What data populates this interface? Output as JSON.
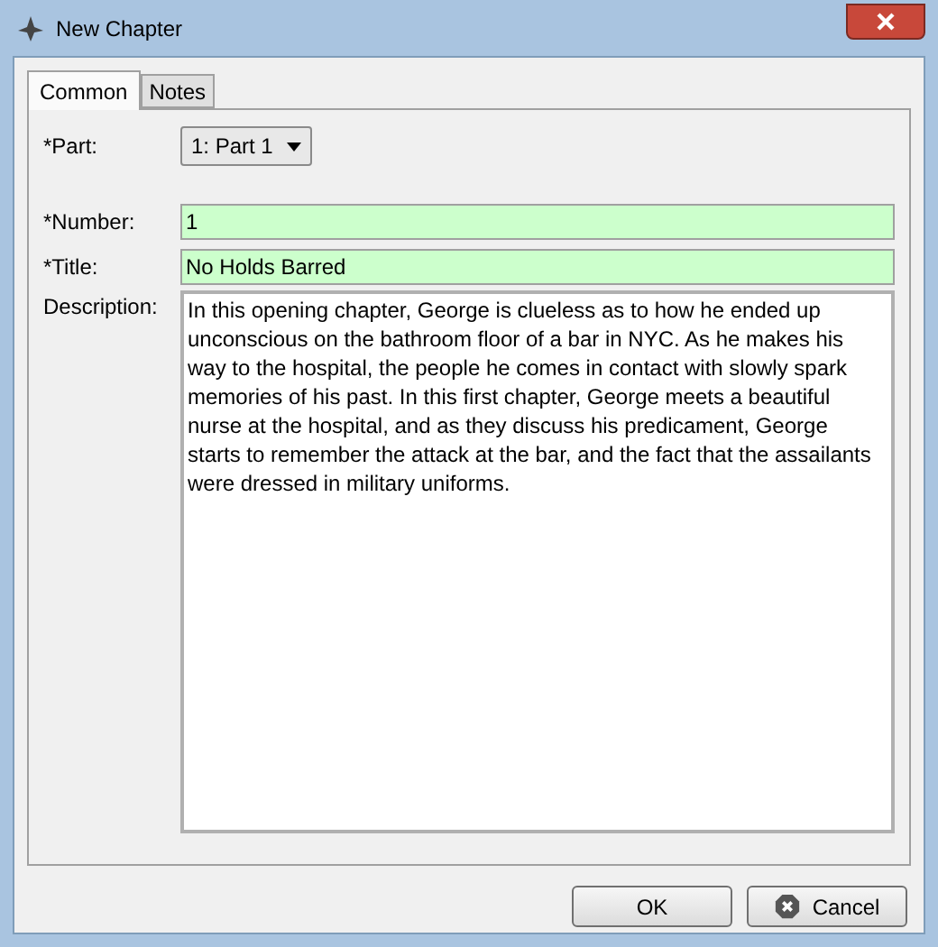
{
  "window": {
    "title": "New Chapter"
  },
  "tabs": [
    {
      "label": "Common",
      "selected": true
    },
    {
      "label": "Notes",
      "selected": false
    }
  ],
  "form": {
    "part": {
      "label": "*Part:",
      "value": "1: Part 1"
    },
    "number": {
      "label": "*Number:",
      "value": "1"
    },
    "title": {
      "label": "*Title:",
      "value": "No Holds Barred"
    },
    "description": {
      "label": "Description:",
      "value": "In this opening chapter, George is clueless as to how he ended up unconscious on the bathroom floor of a bar in NYC. As he makes his way to the hospital, the people he comes in contact with slowly spark memories of his past. In this first chapter, George meets a beautiful nurse at the hospital, and as they discuss his predicament, George starts to remember the attack at the bar, and the fact that the assailants were dressed in military uniforms."
    }
  },
  "buttons": [
    {
      "label": "OK",
      "kind": "ok"
    },
    {
      "label": "Cancel",
      "kind": "cancel"
    }
  ]
}
